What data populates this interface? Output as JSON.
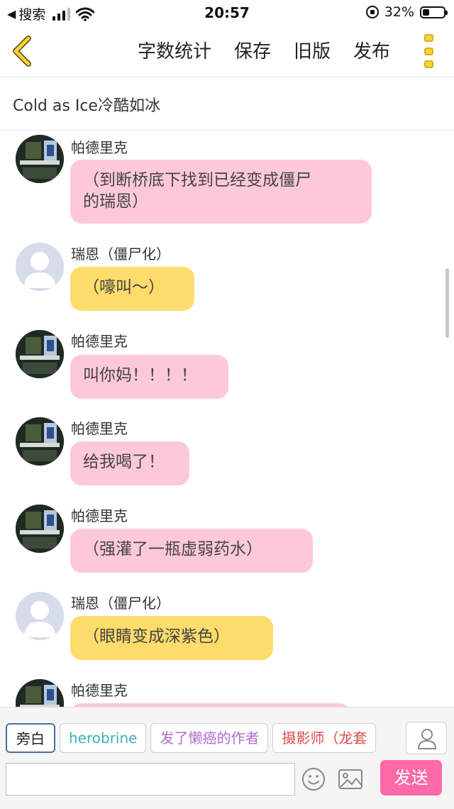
{
  "status_bar": {
    "back_app": "搜索",
    "time": "20:57",
    "battery": "32%",
    "battery_level": 0.32
  },
  "nav": {
    "items": [
      "字数统计",
      "保存",
      "旧版",
      "发布"
    ]
  },
  "title": "Cold as Ice冷酷如冰",
  "messages": [
    {
      "sender": "帕德里克",
      "text_lines": [
        "（到断桥底下找到已经变成僵尸",
        "的瑞恩）"
      ],
      "style": "pink",
      "avatar": "patrick"
    },
    {
      "sender": "瑞恩（僵尸化）",
      "text_lines": [
        "（嚎叫～）"
      ],
      "style": "yellow",
      "avatar": "generic"
    },
    {
      "sender": "帕德里克",
      "text_lines": [
        "叫你妈！！！！"
      ],
      "style": "pink",
      "avatar": "patrick"
    },
    {
      "sender": "帕德里克",
      "text_lines": [
        "给我喝了！"
      ],
      "style": "pink",
      "avatar": "patrick"
    },
    {
      "sender": "帕德里克",
      "text_lines": [
        "（强灌了一瓶虚弱药水）"
      ],
      "style": "pink",
      "avatar": "patrick"
    },
    {
      "sender": "瑞恩（僵尸化）",
      "text_lines": [
        "（眼睛变成深紫色）"
      ],
      "style": "yellow",
      "avatar": "generic"
    },
    {
      "sender": "帕德里克",
      "text_lines": [
        ""
      ],
      "style": "pink",
      "avatar": "patrick"
    }
  ],
  "roles": [
    "旁白",
    "herobrine",
    "发了懒癌的作者",
    "摄影师（龙套"
  ],
  "input": {
    "value": "",
    "placeholder": ""
  },
  "send_label": "发送",
  "icons": {
    "back": "chevron-left-icon",
    "more": "more-vertical-icon",
    "user": "user-icon",
    "emoji": "smiley-icon",
    "image": "image-icon"
  },
  "colors": {
    "accent": "#f6d23f",
    "pink_bubble": "#fec9d7",
    "yellow_bubble": "#fddc6b",
    "send": "#fe6aa7"
  }
}
